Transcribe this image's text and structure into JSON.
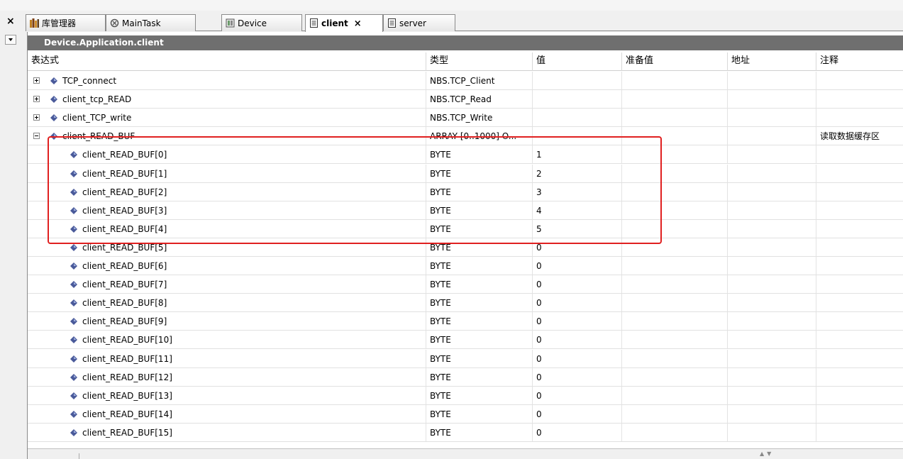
{
  "tabs": [
    {
      "label": "库管理器",
      "icon": "library-icon",
      "active": false
    },
    {
      "label": "MainTask",
      "icon": "task-icon",
      "active": false
    },
    {
      "label": "Device",
      "icon": "device-icon",
      "active": false
    },
    {
      "label": "client",
      "icon": "document-icon",
      "active": true,
      "close": "×"
    },
    {
      "label": "server",
      "icon": "document-icon",
      "active": false
    }
  ],
  "panel": {
    "title": "Device.Application.client",
    "side_close": "×"
  },
  "columns": [
    "表达式",
    "类型",
    "值",
    "准备值",
    "地址",
    "注释"
  ],
  "rows": [
    {
      "name": "TCP_connect",
      "type": "NBS.TCP_Client",
      "value": "",
      "prepared": "",
      "address": "",
      "comment": "",
      "level": 0,
      "expander": "plus"
    },
    {
      "name": "client_tcp_READ",
      "type": "NBS.TCP_Read",
      "value": "",
      "prepared": "",
      "address": "",
      "comment": "",
      "level": 0,
      "expander": "plus"
    },
    {
      "name": "client_TCP_write",
      "type": "NBS.TCP_Write",
      "value": "",
      "prepared": "",
      "address": "",
      "comment": "",
      "level": 0,
      "expander": "plus"
    },
    {
      "name": "client_READ_BUF",
      "type": "ARRAY [0..1000] O...",
      "value": "",
      "prepared": "",
      "address": "",
      "comment": "读取数据缓存区",
      "level": 0,
      "expander": "minus"
    },
    {
      "name": "client_READ_BUF[0]",
      "type": "BYTE",
      "value": "1",
      "prepared": "",
      "address": "",
      "comment": "",
      "level": 1
    },
    {
      "name": "client_READ_BUF[1]",
      "type": "BYTE",
      "value": "2",
      "prepared": "",
      "address": "",
      "comment": "",
      "level": 1
    },
    {
      "name": "client_READ_BUF[2]",
      "type": "BYTE",
      "value": "3",
      "prepared": "",
      "address": "",
      "comment": "",
      "level": 1
    },
    {
      "name": "client_READ_BUF[3]",
      "type": "BYTE",
      "value": "4",
      "prepared": "",
      "address": "",
      "comment": "",
      "level": 1
    },
    {
      "name": "client_READ_BUF[4]",
      "type": "BYTE",
      "value": "5",
      "prepared": "",
      "address": "",
      "comment": "",
      "level": 1
    },
    {
      "name": "client_READ_BUF[5]",
      "type": "BYTE",
      "value": "0",
      "prepared": "",
      "address": "",
      "comment": "",
      "level": 1
    },
    {
      "name": "client_READ_BUF[6]",
      "type": "BYTE",
      "value": "0",
      "prepared": "",
      "address": "",
      "comment": "",
      "level": 1
    },
    {
      "name": "client_READ_BUF[7]",
      "type": "BYTE",
      "value": "0",
      "prepared": "",
      "address": "",
      "comment": "",
      "level": 1
    },
    {
      "name": "client_READ_BUF[8]",
      "type": "BYTE",
      "value": "0",
      "prepared": "",
      "address": "",
      "comment": "",
      "level": 1
    },
    {
      "name": "client_READ_BUF[9]",
      "type": "BYTE",
      "value": "0",
      "prepared": "",
      "address": "",
      "comment": "",
      "level": 1
    },
    {
      "name": "client_READ_BUF[10]",
      "type": "BYTE",
      "value": "0",
      "prepared": "",
      "address": "",
      "comment": "",
      "level": 1
    },
    {
      "name": "client_READ_BUF[11]",
      "type": "BYTE",
      "value": "0",
      "prepared": "",
      "address": "",
      "comment": "",
      "level": 1
    },
    {
      "name": "client_READ_BUF[12]",
      "type": "BYTE",
      "value": "0",
      "prepared": "",
      "address": "",
      "comment": "",
      "level": 1
    },
    {
      "name": "client_READ_BUF[13]",
      "type": "BYTE",
      "value": "0",
      "prepared": "",
      "address": "",
      "comment": "",
      "level": 1
    },
    {
      "name": "client_READ_BUF[14]",
      "type": "BYTE",
      "value": "0",
      "prepared": "",
      "address": "",
      "comment": "",
      "level": 1
    },
    {
      "name": "client_READ_BUF[15]",
      "type": "BYTE",
      "value": "0",
      "prepared": "",
      "address": "",
      "comment": "",
      "level": 1
    }
  ],
  "highlight": {
    "color": "#e02020"
  },
  "colors": {
    "titlebar": "#6f6f6f",
    "variable_icon": "#4a5a9a"
  }
}
